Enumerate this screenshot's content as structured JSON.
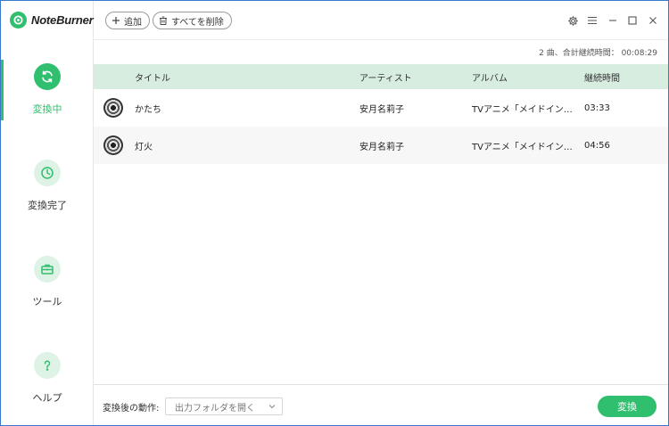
{
  "app": {
    "name": "NoteBurner"
  },
  "sidebar": {
    "items": [
      {
        "label": "変換中",
        "icon": "refresh-icon",
        "active": true
      },
      {
        "label": "変換完了",
        "icon": "clock-icon",
        "active": false
      },
      {
        "label": "ツール",
        "icon": "toolbox-icon",
        "active": false
      },
      {
        "label": "ヘルプ",
        "icon": "question-icon",
        "active": false
      }
    ]
  },
  "toolbar": {
    "add_label": "追加",
    "delete_all_label": "すべてを削除"
  },
  "summary": "2 曲、合計継続時間： 00:08:29",
  "table": {
    "headers": {
      "title": "タイトル",
      "artist": "アーティスト",
      "album": "アルバム",
      "duration": "継続時間"
    },
    "rows": [
      {
        "title": "かたち",
        "artist": "安月名莉子",
        "album": "TVアニメ「メイドインア…",
        "duration": "03:33"
      },
      {
        "title": "灯火",
        "artist": "安月名莉子",
        "album": "TVアニメ「メイドインア…",
        "duration": "04:56"
      }
    ]
  },
  "bottom": {
    "after_label": "変換後の動作:",
    "after_value": "出力フォルダを開く",
    "convert_label": "変換"
  },
  "colors": {
    "accent": "#2fbf6e",
    "header_bg": "#d7ede0",
    "frame": "#3a78c9"
  }
}
